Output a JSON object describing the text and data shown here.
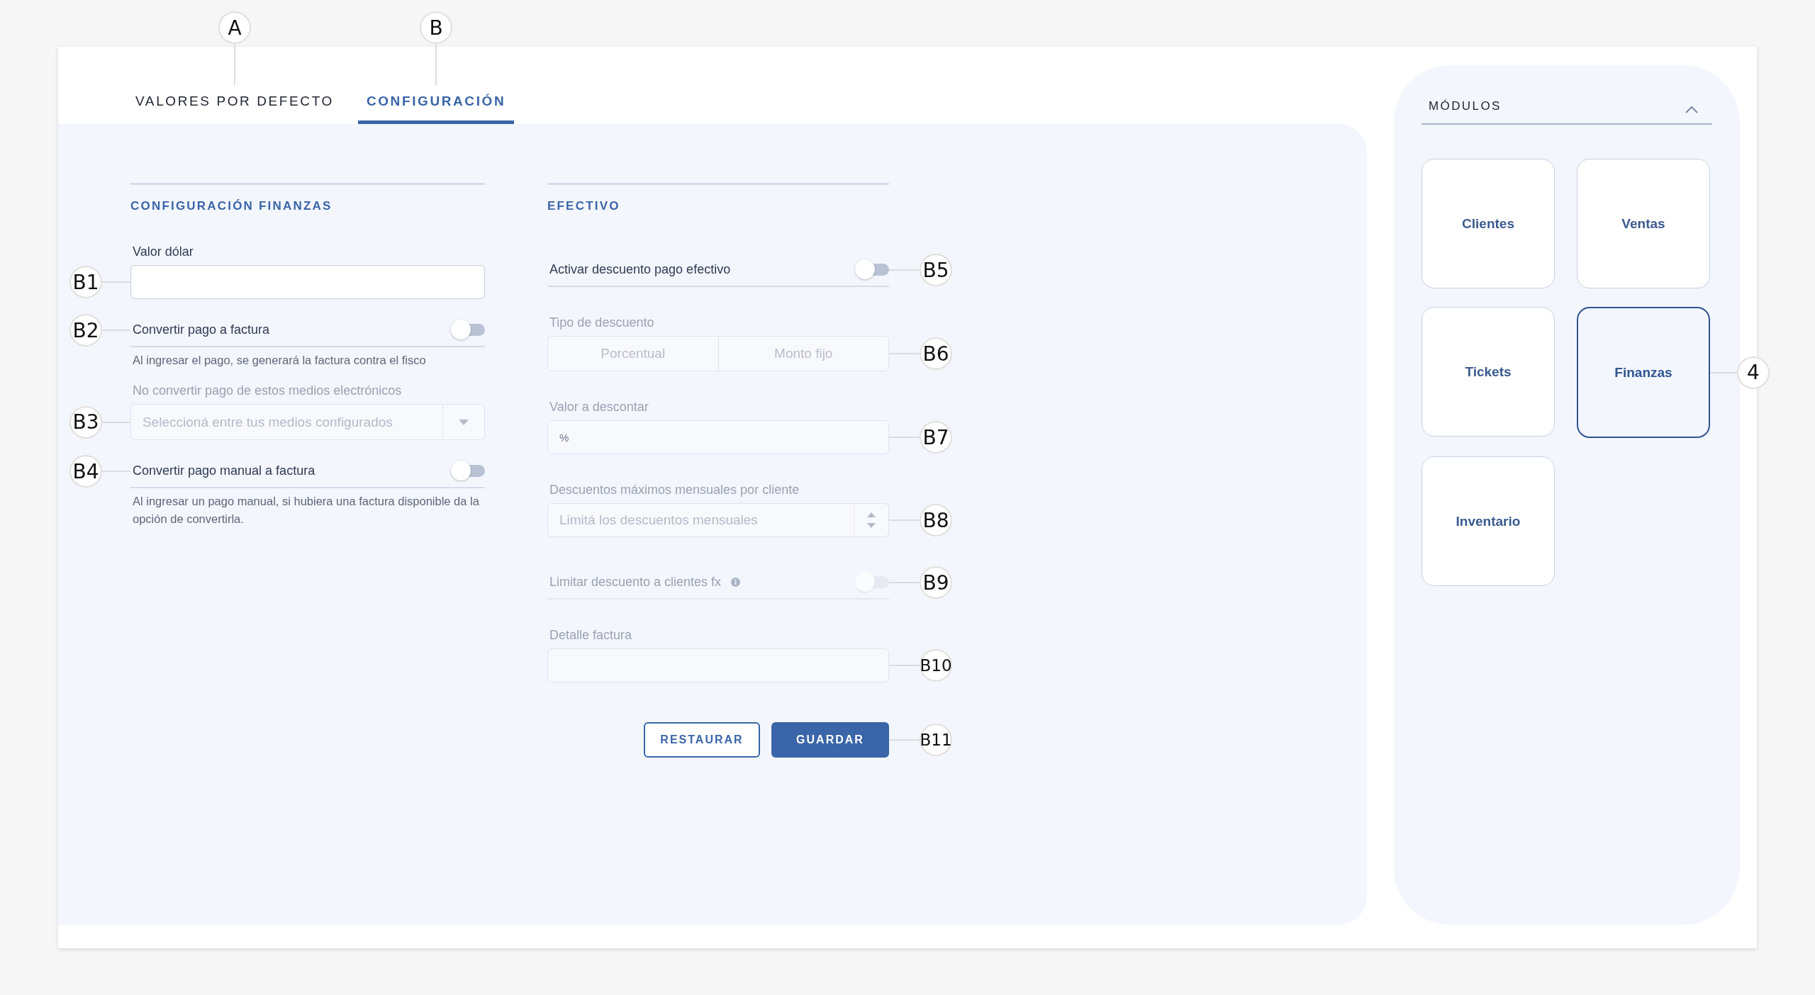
{
  "tabs": [
    {
      "label": "VALORES POR DEFECTO",
      "selected": false,
      "callout": "A"
    },
    {
      "label": "CONFIGURACIÓN",
      "selected": true,
      "callout": "B"
    }
  ],
  "sections": [
    {
      "title": "CONFIGURACIÓN FINANZAS",
      "fields": [
        {
          "kind": "text",
          "label": "Valor dólar",
          "disabled": false,
          "callout": "B1"
        },
        {
          "kind": "toggle",
          "label": "Convertir pago a factura",
          "on": false,
          "disabled": false,
          "callout": "B2",
          "help": "Al ingresar el pago, se generará la factura contra el fisco"
        },
        {
          "kind": "select",
          "label": "No convertir pago de estos medios electrónicos",
          "placeholder": "Seleccioná entre tus medios configurados",
          "disabled": true,
          "callout": "B3"
        },
        {
          "kind": "toggle",
          "label": "Convertir pago manual a factura",
          "on": false,
          "disabled": false,
          "callout": "B4",
          "help": "Al ingresar un pago manual, si hubiera una factura disponible da la opción de convertirla."
        }
      ]
    },
    {
      "title": "EFECTIVO",
      "fields": [
        {
          "kind": "toggle",
          "label": "Activar descuento pago efectivo",
          "on": false,
          "disabled": false,
          "callout": "B5"
        },
        {
          "kind": "segmented",
          "label": "Tipo de descuento",
          "disabled": true,
          "callout": "B6",
          "options": [
            {
              "label": "Porcentual",
              "selected": false
            },
            {
              "label": "Monto fijo",
              "selected": false
            }
          ]
        },
        {
          "kind": "text",
          "label": "Valor a descontar",
          "unit": "%",
          "disabled": true,
          "callout": "B7"
        },
        {
          "kind": "number",
          "label": "Descuentos máximos mensuales por cliente",
          "placeholder": "Limitá los descuentos mensuales",
          "disabled": true,
          "callout": "B8"
        },
        {
          "kind": "toggle",
          "label": "Limitar descuento a clientes fx",
          "on": false,
          "disabled": true,
          "info": true,
          "callout": "B9"
        },
        {
          "kind": "text",
          "label": "Detalle factura",
          "disabled": true,
          "callout": "B10"
        }
      ]
    }
  ],
  "actions": {
    "callout": "B11",
    "buttons": [
      {
        "label": "RESTAURAR",
        "kind": "secondary"
      },
      {
        "label": "GUARDAR",
        "kind": "primary"
      }
    ]
  },
  "modules": {
    "title": "MÓDULOS",
    "expanded": true,
    "items": [
      {
        "label": "Clientes",
        "selected": false
      },
      {
        "label": "Ventas",
        "selected": false
      },
      {
        "label": "Tickets",
        "selected": false
      },
      {
        "label": "Finanzas",
        "selected": true,
        "callout": "4"
      },
      {
        "label": "Inventario",
        "selected": false
      }
    ]
  }
}
